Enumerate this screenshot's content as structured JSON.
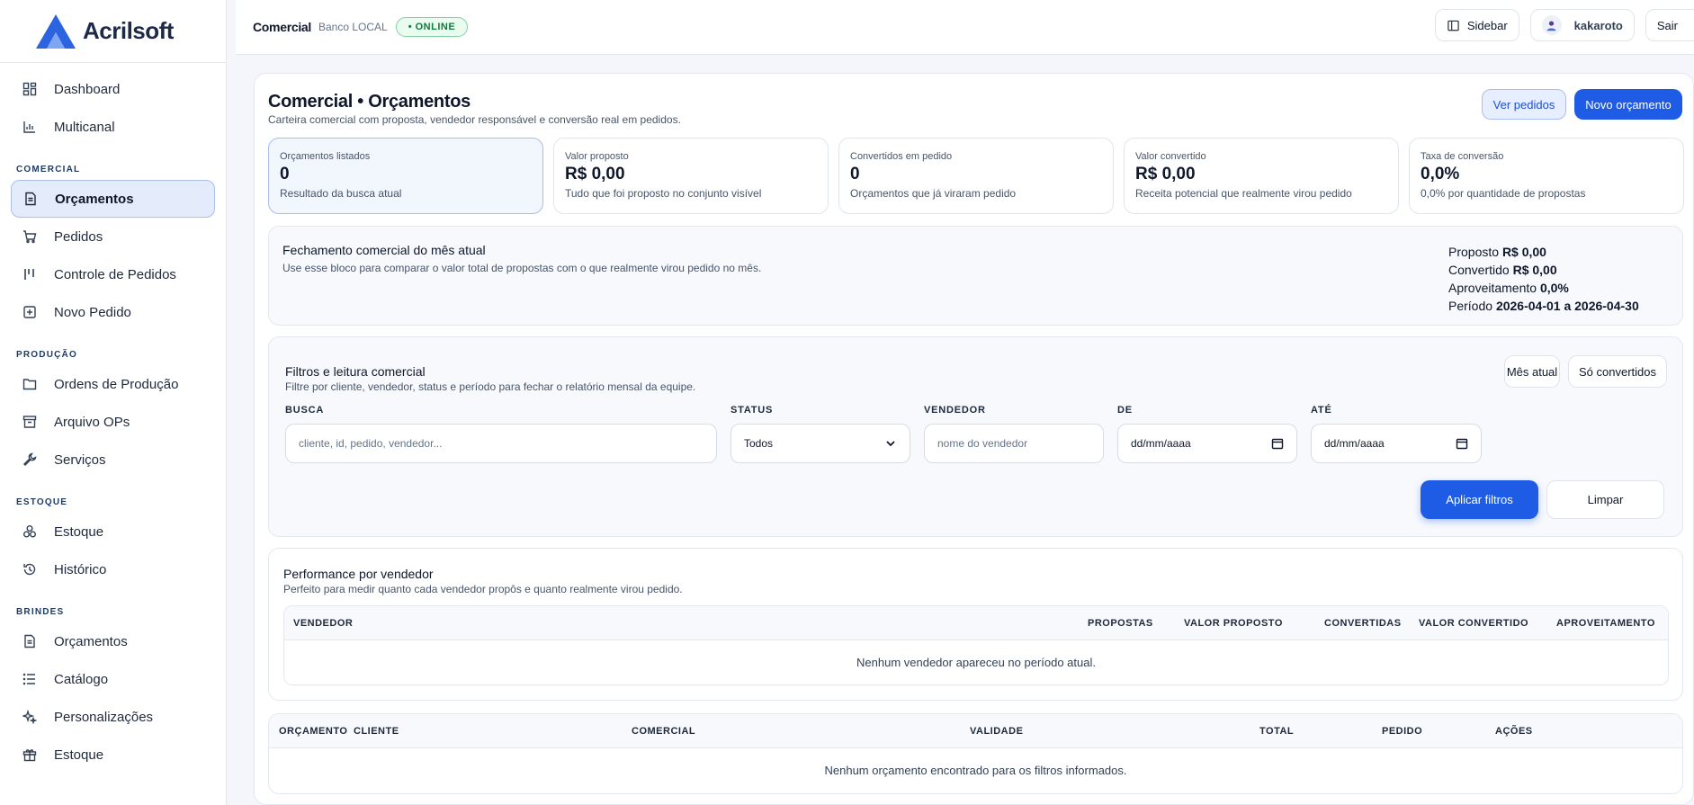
{
  "brand": {
    "name": "Acrilsoft"
  },
  "sidebar": {
    "top_items": [
      {
        "label": "Dashboard",
        "icon": "dashboard-icon"
      },
      {
        "label": "Multicanal",
        "icon": "bar-chart-icon"
      }
    ],
    "sections": [
      {
        "title": "COMERCIAL",
        "items": [
          {
            "label": "Orçamentos",
            "icon": "document-icon",
            "active": true
          },
          {
            "label": "Pedidos",
            "icon": "cart-icon"
          },
          {
            "label": "Controle de Pedidos",
            "icon": "columns-icon"
          },
          {
            "label": "Novo Pedido",
            "icon": "plus-square-icon"
          }
        ]
      },
      {
        "title": "PRODUÇÃO",
        "items": [
          {
            "label": "Ordens de Produção",
            "icon": "folder-icon"
          },
          {
            "label": "Arquivo OPs",
            "icon": "archive-icon"
          },
          {
            "label": "Serviços",
            "icon": "wrench-icon"
          }
        ]
      },
      {
        "title": "ESTOQUE",
        "items": [
          {
            "label": "Estoque",
            "icon": "boxes-icon"
          },
          {
            "label": "Histórico",
            "icon": "history-icon"
          }
        ]
      },
      {
        "title": "BRINDES",
        "items": [
          {
            "label": "Orçamentos",
            "icon": "document-icon"
          },
          {
            "label": "Catálogo",
            "icon": "list-icon"
          },
          {
            "label": "Personalizações",
            "icon": "sparkles-icon"
          },
          {
            "label": "Estoque",
            "icon": "gift-icon"
          }
        ]
      }
    ]
  },
  "topbar": {
    "module": "Comercial",
    "db": "Banco LOCAL",
    "status": "• ONLINE",
    "sidebar_label": "Sidebar",
    "user": "kakaroto",
    "logout_label": "Sair"
  },
  "page": {
    "title": "Comercial • Orçamentos",
    "subtitle": "Carteira comercial com proposta, vendedor responsável e conversão real em pedidos.",
    "btn_orders": "Ver pedidos",
    "btn_new": "Novo orçamento"
  },
  "kpis": [
    {
      "label": "Orçamentos listados",
      "value": "0",
      "note": "Resultado da busca atual",
      "highlight": true
    },
    {
      "label": "Valor proposto",
      "value": "R$ 0,00",
      "note": "Tudo que foi proposto no conjunto visível"
    },
    {
      "label": "Convertidos em pedido",
      "value": "0",
      "note": "Orçamentos que já viraram pedido"
    },
    {
      "label": "Valor convertido",
      "value": "R$ 0,00",
      "note": "Receita potencial que realmente virou pedido"
    },
    {
      "label": "Taxa de conversão",
      "value": "0,0%",
      "note": "0,0% por quantidade de propostas"
    }
  ],
  "month": {
    "title": "Fechamento comercial do mês atual",
    "subtitle": "Use esse bloco para comparar o valor total de propostas com o que realmente virou pedido no mês.",
    "rows": [
      {
        "label": "Proposto",
        "value": "R$ 0,00"
      },
      {
        "label": "Convertido",
        "value": "R$ 0,00"
      },
      {
        "label": "Aproveitamento",
        "value": "0,0%"
      },
      {
        "label": "Período",
        "value": "2026-04-01 a 2026-04-30"
      }
    ]
  },
  "filters": {
    "title": "Filtros e leitura comercial",
    "subtitle": "Filtre por cliente, vendedor, status e período para fechar o relatório mensal da equipe.",
    "btn_month": "Mês atual",
    "btn_converted": "Só convertidos",
    "search_label": "BUSCA",
    "search_placeholder": "cliente, id, pedido, vendedor...",
    "status_label": "STATUS",
    "status_value": "Todos",
    "seller_label": "VENDEDOR",
    "seller_placeholder": "nome do vendedor",
    "from_label": "DE",
    "from_value": "dd/mm/aaaa",
    "to_label": "ATÉ",
    "to_value": "dd/mm/aaaa",
    "apply": "Aplicar filtros",
    "clear": "Limpar"
  },
  "performance": {
    "title": "Performance por vendedor",
    "subtitle": "Perfeito para medir quanto cada vendedor propôs e quanto realmente virou pedido.",
    "columns": [
      "VENDEDOR",
      "PROPOSTAS",
      "VALOR PROPOSTO",
      "CONVERTIDAS",
      "VALOR CONVERTIDO",
      "APROVEITAMENTO"
    ],
    "empty": "Nenhum vendedor apareceu no período atual."
  },
  "quotes": {
    "columns": [
      "ORÇAMENTO",
      "CLIENTE",
      "COMERCIAL",
      "VALIDADE",
      "TOTAL",
      "PEDIDO",
      "AÇÕES"
    ],
    "empty": "Nenhum orçamento encontrado para os filtros informados."
  },
  "colors": {
    "accent": "#1f5ce6",
    "online": "#137a3d",
    "brand": "#2b63e0"
  }
}
